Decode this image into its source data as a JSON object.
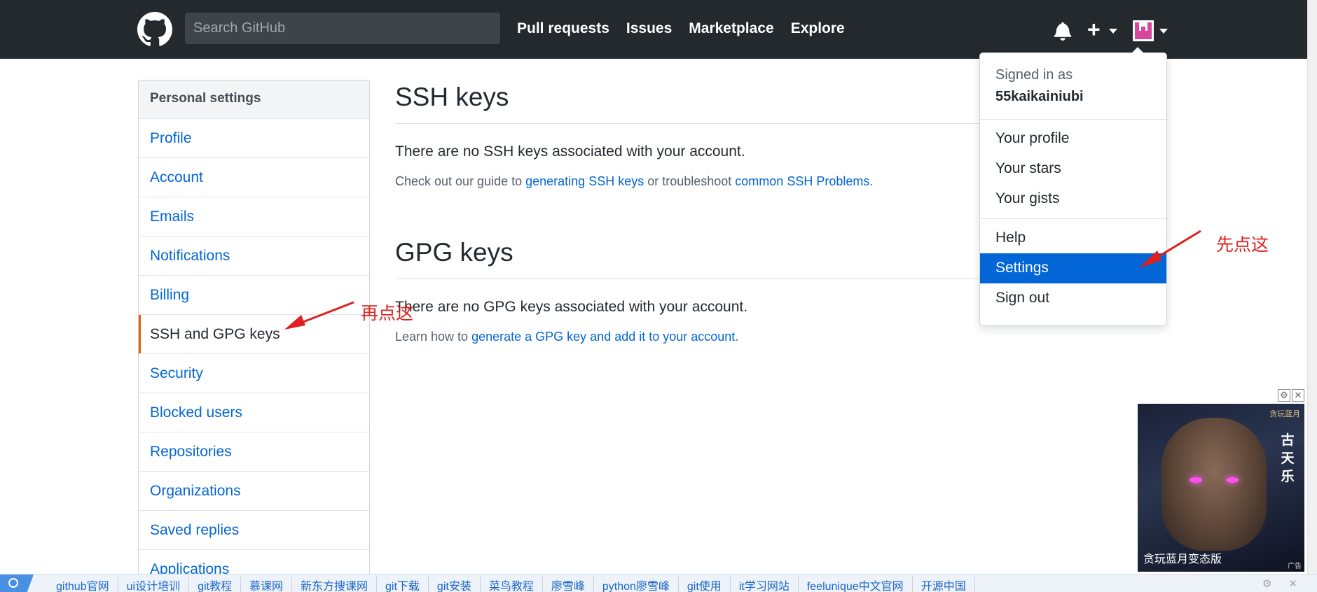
{
  "header": {
    "search_placeholder": "Search GitHub",
    "nav": [
      "Pull requests",
      "Issues",
      "Marketplace",
      "Explore"
    ]
  },
  "sidebar": {
    "heading": "Personal settings",
    "items": [
      {
        "label": "Profile"
      },
      {
        "label": "Account"
      },
      {
        "label": "Emails"
      },
      {
        "label": "Notifications"
      },
      {
        "label": "Billing"
      },
      {
        "label": "SSH and GPG keys",
        "selected": true
      },
      {
        "label": "Security"
      },
      {
        "label": "Blocked users"
      },
      {
        "label": "Repositories"
      },
      {
        "label": "Organizations"
      },
      {
        "label": "Saved replies"
      },
      {
        "label": "Applications"
      }
    ]
  },
  "ssh": {
    "title": "SSH keys",
    "empty": "There are no SSH keys associated with your account.",
    "guide_prefix": "Check out our guide to ",
    "guide_link": "generating SSH keys",
    "guide_mid": " or troubleshoot ",
    "guide_link2": "common SSH Problems",
    "guide_suffix": "."
  },
  "gpg": {
    "title": "GPG keys",
    "empty": "There are no GPG keys associated with your account.",
    "learn_prefix": "Learn how to ",
    "learn_link": "generate a GPG key and add it to your account",
    "learn_suffix": "."
  },
  "dropdown": {
    "signed_in_as": "Signed in as",
    "username": "55kaikainiubi",
    "items": [
      "Your profile",
      "Your stars",
      "Your gists"
    ],
    "items2": [
      "Help",
      "Settings",
      "Sign out"
    ],
    "active": "Settings"
  },
  "annotations": {
    "first": "先点这",
    "second": "再点这"
  },
  "ad": {
    "side_text": [
      "古",
      "天",
      "乐"
    ],
    "caption": "贪玩蓝月变态版",
    "corner": "广告",
    "logo_text": "贪玩蓝月"
  },
  "bookmarks": [
    "github官网",
    "ui设计培训",
    "git教程",
    "慕课网",
    "新东方搜课网",
    "git下载",
    "git安装",
    "菜鸟教程",
    "廖雪峰",
    "python廖雪峰",
    "git使用",
    "it学习网站",
    "feelunique中文官网",
    "开源中国"
  ],
  "colors": {
    "header_bg": "#24292e",
    "link": "#0366d6",
    "selected_accent": "#e36209",
    "annotation": "#e02020"
  }
}
